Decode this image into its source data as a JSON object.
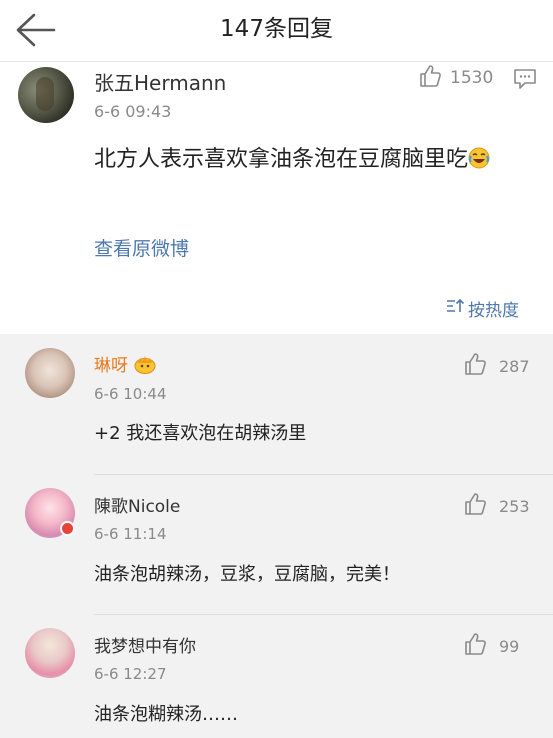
{
  "header": {
    "back_icon": "arrow-left-icon",
    "title": "147条回复"
  },
  "main_comment": {
    "author": "张五Hermann",
    "time": "6-6 09:43",
    "likes": "1530",
    "text": "北方人表示喜欢拿油条泡在豆腐脑里吃",
    "emoji": "laughing-crying-emoji",
    "view_original": "查看原微博",
    "sort_label": "按热度"
  },
  "replies": [
    {
      "author": "琳呀",
      "badge": "crown-badge",
      "time": "6-6 10:44",
      "likes": "287",
      "text": "+2 我还喜欢泡在胡辣汤里"
    },
    {
      "author": "陳歌Nicole",
      "time": "6-6 11:14",
      "likes": "253",
      "text": "油条泡胡辣汤，豆浆，豆腐脑，完美！"
    },
    {
      "author": "我梦想中有你",
      "time": "6-6 12:27",
      "likes": "99",
      "text": "油条泡糊辣汤……"
    }
  ],
  "colors": {
    "link": "#4d78b0",
    "vip_name": "#ea7a1d",
    "muted": "#8a8a8a"
  }
}
